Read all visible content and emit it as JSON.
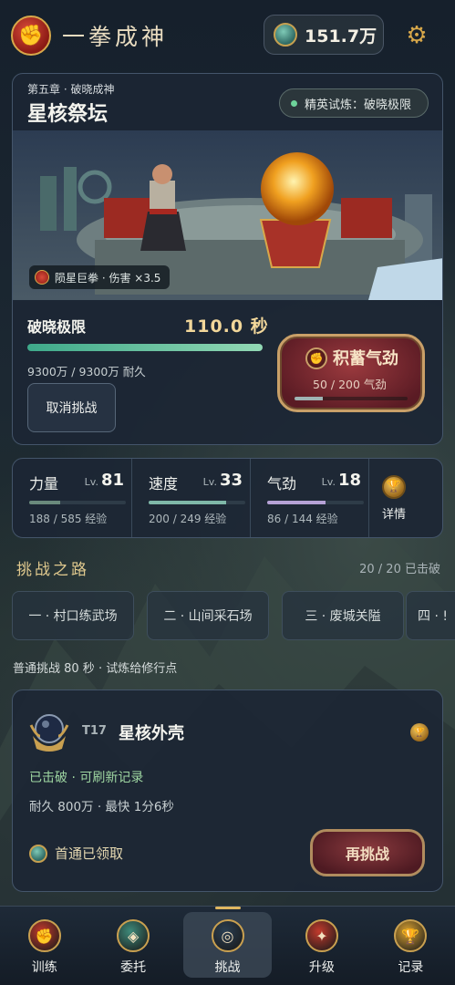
{
  "app": {
    "title": "一拳成神"
  },
  "header": {
    "currency_value": "151.7万"
  },
  "stage": {
    "chapter": "第五章 · 破晓成神",
    "name": "星核祭坛",
    "trial_badge": "精英试炼：破晓极限",
    "weapon_tag": "陨星巨拳 · 伤害 ×3.5",
    "boss_name": "破晓极限",
    "boss_time": "110.0 秒",
    "hp_text": "9300万 / 9300万 耐久",
    "hp_fraction": 1.0,
    "cancel_label": "取消挑战",
    "charge": {
      "label": "积蓄气劲",
      "progress_text": "50 / 200 气劲",
      "fraction": 0.25
    }
  },
  "stats": [
    {
      "name": "力量",
      "lv_prefix": "Lv.",
      "level": "81",
      "exp": "188 / 585 经验",
      "fraction": 0.32,
      "color": "#6a8a7c"
    },
    {
      "name": "速度",
      "lv_prefix": "Lv.",
      "level": "33",
      "exp": "200 / 249 经验",
      "fraction": 0.8,
      "color": "#7fb8a8"
    },
    {
      "name": "气劲",
      "lv_prefix": "Lv.",
      "level": "18",
      "exp": "86 / 144 经验",
      "fraction": 0.6,
      "color": "#b6a2d6"
    }
  ],
  "detail_label": "详情",
  "road": {
    "title": "挑战之路",
    "count": "20 / 20 已击破",
    "tabs": [
      "一 · 村口练武场",
      "二 · 山间采石场",
      "三 · 废城关隘",
      "四 · !"
    ],
    "note": "普通挑战 80 秒 · 试炼给修行点"
  },
  "challenge": {
    "tier": "T17",
    "name": "星核外壳",
    "status": "已击破 · 可刷新记录",
    "meta": "耐久 800万 · 最快 1分6秒",
    "reward": "首通已领取",
    "button": "再挑战"
  },
  "nav": [
    {
      "label": "训练",
      "icon": "fist-icon",
      "color": "#c23a2c"
    },
    {
      "label": "委托",
      "icon": "jade-coin-icon",
      "color": "#3e8a7a"
    },
    {
      "label": "挑战",
      "icon": "target-icon",
      "color": "#2a3e52"
    },
    {
      "label": "升级",
      "icon": "flame-icon",
      "color": "#c23a2c"
    },
    {
      "label": "记录",
      "icon": "trophy-icon",
      "color": "#d8a030"
    }
  ]
}
